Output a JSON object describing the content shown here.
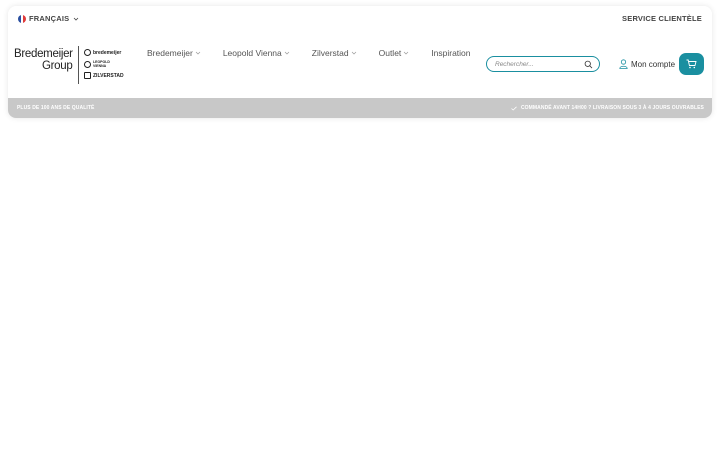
{
  "topbar": {
    "language_label": "FRANÇAIS",
    "service_label": "SERVICE CLIENTÈLE",
    "flag_colors": [
      "#2a4fa0",
      "#ffffff",
      "#e03a3a"
    ]
  },
  "logo": {
    "line1": "Bredemeijer",
    "line2": "Group",
    "brands": [
      "bredemeijer",
      "LEOPOLD VIENNA",
      "ZILVERSTAD"
    ]
  },
  "nav": {
    "items": [
      {
        "label": "Bredemeijer",
        "dropdown": true
      },
      {
        "label": "Leopold Vienna",
        "dropdown": true
      },
      {
        "label": "Zilverstad",
        "dropdown": true
      },
      {
        "label": "Outlet",
        "dropdown": true
      },
      {
        "label": "Inspiration",
        "dropdown": false
      }
    ]
  },
  "search": {
    "placeholder": "Rechercher...",
    "value": ""
  },
  "account": {
    "label": "Mon compte"
  },
  "usp": {
    "left": "PLUS DE 100 ANS DE QUALITÉ",
    "right": "COMMANDÉ AVANT 14H00 ? LIVRAISON SOUS 3 À 4 JOURS OUVRABLES"
  },
  "colors": {
    "accent": "#1a8fa0",
    "usp_bar": "#c8c8c8"
  },
  "icons": {
    "language_chevron": "chevron-down-icon",
    "search": "search-icon",
    "account": "user-icon",
    "cart": "cart-icon",
    "usp_check": "check-icon"
  }
}
